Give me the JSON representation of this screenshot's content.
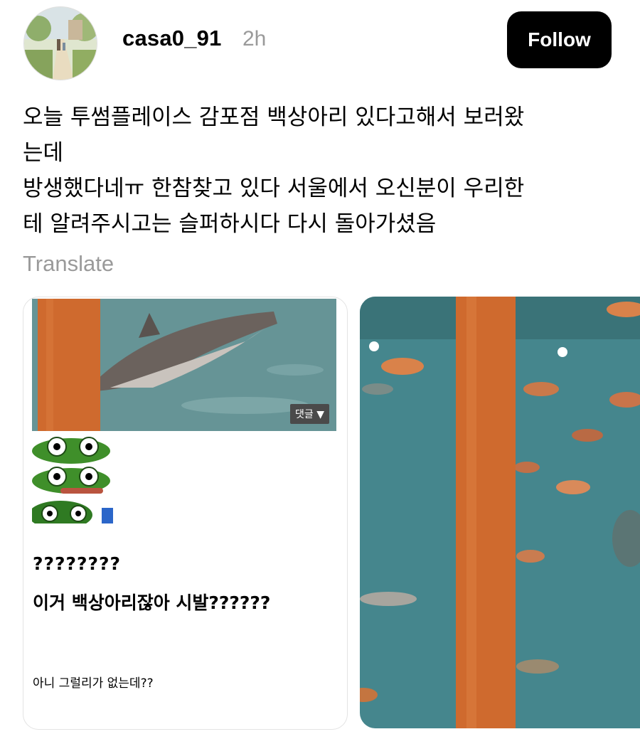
{
  "post": {
    "username": "casa0_91",
    "time": "2h",
    "follow_label": "Follow",
    "text_lines": [
      "오늘 투썸플레이스 감포점 백상아리 있다고해서 보러왔",
      "는데",
      "방생했다네ㅠ 한참찾고 있다 서울에서 오신분이 우리한",
      "테 알려주시고는 슬퍼하시다 다시 돌아가셨음"
    ],
    "translate_label": "Translate"
  },
  "card": {
    "comment_tag": "댓글 ▼",
    "line1": "????????",
    "line2": "이거 백상아리잖아 시발??????",
    "line3": "아니 그럴리가 없는데??"
  },
  "colors": {
    "follow_bg": "#000000",
    "muted_text": "#9a9a9a",
    "aquarium_water": "#3f7f86",
    "pillar": "#d2692c"
  },
  "icons": {
    "avatar": "user-avatar-image",
    "meme": "pepe-frog-meme"
  }
}
